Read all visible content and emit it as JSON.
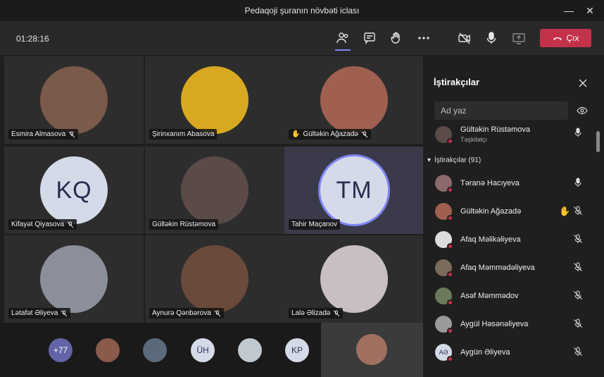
{
  "window": {
    "title": "Pedaqoji şuranın növbəti iclası",
    "minimize": "—",
    "close": "✕"
  },
  "toolbar": {
    "timer": "01:28:16",
    "leave_label": "Çıx"
  },
  "tiles": [
    {
      "name": "Esmira Almasova",
      "type": "photo",
      "bg": "#7a5a4a",
      "muted": true
    },
    {
      "name": "Şirinxanım Abasova",
      "type": "photo",
      "bg": "#d8a820",
      "muted": false
    },
    {
      "name": "Gültəkin Ağazadə",
      "type": "photo",
      "bg": "#a06050",
      "muted": true,
      "hand": "✋"
    },
    {
      "name": "Kifayət Qiyasova",
      "type": "initials",
      "initials": "KQ",
      "muted": true
    },
    {
      "name": "Gültəkin Rüstəmova",
      "type": "photo",
      "bg": "#5a4a48",
      "muted": false
    },
    {
      "name": "Tahir Maçanov",
      "type": "initials",
      "initials": "TM",
      "muted": false,
      "speaking": true
    },
    {
      "name": "Lətafət Əliyeva",
      "type": "photo",
      "bg": "#8a8f9a",
      "muted": true
    },
    {
      "name": "Aynurə Qənbərova",
      "type": "photo",
      "bg": "#6a4a3a",
      "muted": true
    },
    {
      "name": "Lalə Əlizadə",
      "type": "photo",
      "bg": "#c8c0c0",
      "muted": true
    }
  ],
  "strip": [
    {
      "label": "+77",
      "bg": "#6264a7"
    },
    {
      "label": "",
      "bg": "#8a5a4a"
    },
    {
      "label": "",
      "bg": "#5a6a7a"
    },
    {
      "label": "ÜH",
      "bg": "#d5dae8"
    },
    {
      "label": "",
      "bg": "#c0c8d0"
    },
    {
      "label": "KP",
      "bg": "#d5dae8"
    }
  ],
  "panel": {
    "title": "İştirakçılar",
    "search_placeholder": "Ad yaz",
    "organizer": {
      "name": "Gültəkin Rüstəmova",
      "role": "Təşkilatçı",
      "bg": "#5a4a48"
    },
    "section": "İştirakçılar (91)",
    "participants": [
      {
        "name": "Təranə Hacıyeva",
        "bg": "#8a6a6a",
        "muted": false
      },
      {
        "name": "Gültəkin Ağazadə",
        "bg": "#a06050",
        "muted": true,
        "hand": "✋"
      },
      {
        "name": "Afaq Məlikəliyeva",
        "bg": "#ddd",
        "muted": true
      },
      {
        "name": "Afaq Məmmədəliyeva",
        "bg": "#7a6a5a",
        "muted": true
      },
      {
        "name": "Asəf Məmmədov",
        "bg": "#6a7a5a",
        "muted": true
      },
      {
        "name": "Aygül Həsənəliyeva",
        "bg": "#9a9a9a",
        "muted": true
      },
      {
        "name": "Aygün Əliyeva",
        "initials": "AƏ",
        "bg": "#d5dae8",
        "muted": true
      }
    ]
  }
}
